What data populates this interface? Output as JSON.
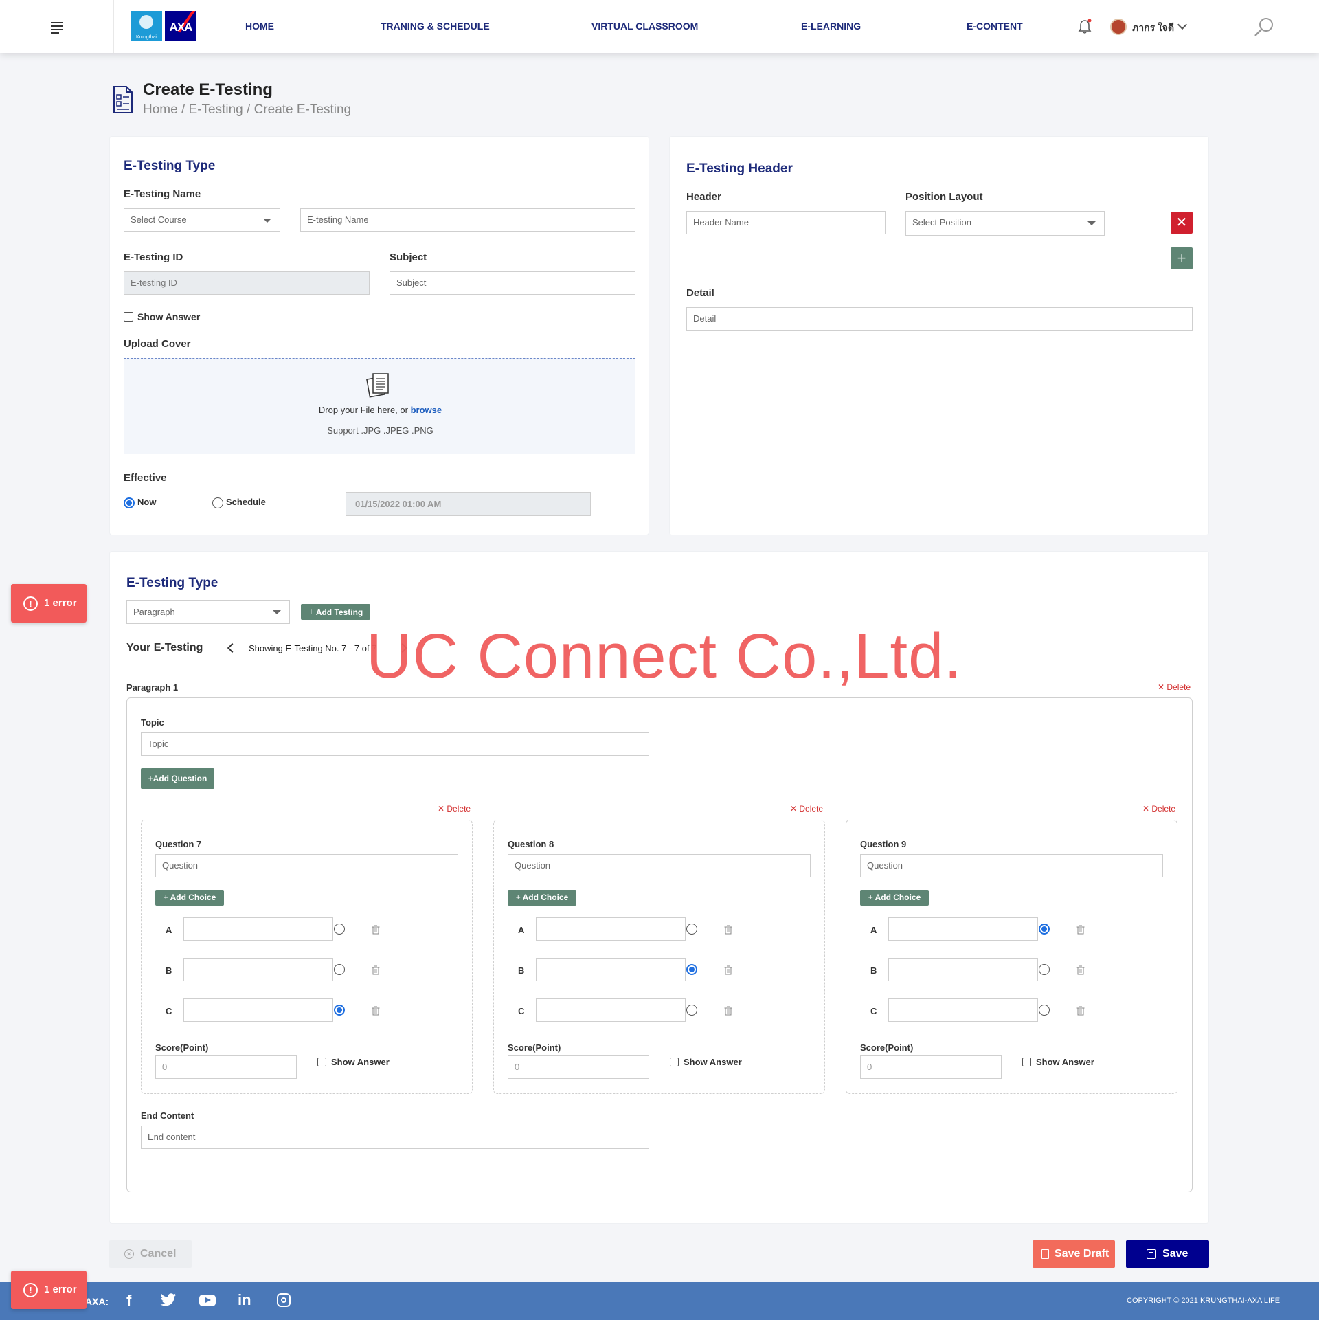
{
  "nav": {
    "brand": "Krungthai",
    "brand_axa": "AXA",
    "links": [
      "HOME",
      "TRANING & SCHEDULE",
      "VIRTUAL CLASSROOM",
      "E-LEARNING",
      "E-CONTENT"
    ],
    "user_name": "ภากร ใจดี"
  },
  "page": {
    "title": "Create E-Testing",
    "breadcrumb": [
      "Home",
      "E-Testing",
      "Create E-Testing"
    ]
  },
  "type_card": {
    "title": "E-Testing Type",
    "name_label": "E-Testing Name",
    "course_placeholder": "Select Course",
    "name_placeholder": "E-testing Name",
    "id_label": "E-Testing ID",
    "id_placeholder": "E-testing ID",
    "subject_label": "Subject",
    "subject_placeholder": "Subject",
    "show_answer": "Show Answer",
    "upload_label": "Upload Cover",
    "drop_text": "Drop your File here, or ",
    "browse": "browse",
    "support": "Support .JPG .JPEG .PNG",
    "effective_label": "Effective",
    "now": "Now",
    "schedule": "Schedule",
    "datetime": "01/15/2022 01:00 AM"
  },
  "header_card": {
    "title": "E-Testing Header",
    "header_label": "Header",
    "header_placeholder": "Header Name",
    "position_label": "Position Layout",
    "position_placeholder": "Select Position",
    "detail_label": "Detail",
    "detail_placeholder": "Detail"
  },
  "bottom": {
    "title": "E-Testing Type",
    "type_value": "Paragraph",
    "add_testing": "Add Testing",
    "your_label": "Your E-Testing",
    "showing": "Showing E-Testing No. 7 - 7 of 7",
    "watermark": "UC Connect Co.,Ltd.",
    "paragraph_label": "Paragraph 1",
    "delete": "Delete",
    "topic_label": "Topic",
    "topic_placeholder": "Topic",
    "add_question": "Add Question",
    "end_label": "End Content",
    "end_placeholder": "End content",
    "questions": [
      {
        "label": "Question 7",
        "placeholder": "Question",
        "add_choice": "Add Choice",
        "choices": [
          "A",
          "B",
          "C"
        ],
        "selected": "C",
        "score_label": "Score(Point)",
        "score": "0",
        "show_answer": "Show Answer"
      },
      {
        "label": "Question 8",
        "placeholder": "Question",
        "add_choice": "Add Choice",
        "choices": [
          "A",
          "B",
          "C"
        ],
        "selected": "B",
        "score_label": "Score(Point)",
        "score": "0",
        "show_answer": "Show Answer"
      },
      {
        "label": "Question 9",
        "placeholder": "Question",
        "add_choice": "Add Choice",
        "choices": [
          "A",
          "B",
          "C"
        ],
        "selected": "A",
        "score_label": "Score(Point)",
        "score": "0",
        "show_answer": "Show Answer"
      }
    ]
  },
  "actions": {
    "cancel": "Cancel",
    "save_draft": "Save Draft",
    "save": "Save"
  },
  "errors": {
    "label": "1 error"
  },
  "footer": {
    "prefix": "AXA:",
    "copyright": "COPYRIGHT © 2021 KRUNGTHAI-AXA LIFE"
  },
  "colors": {
    "brand_navy": "#1d2a7a",
    "green": "#5e8574",
    "danger": "#d32f2f",
    "draft": "#f26b5b",
    "footer": "#4a78b8"
  }
}
